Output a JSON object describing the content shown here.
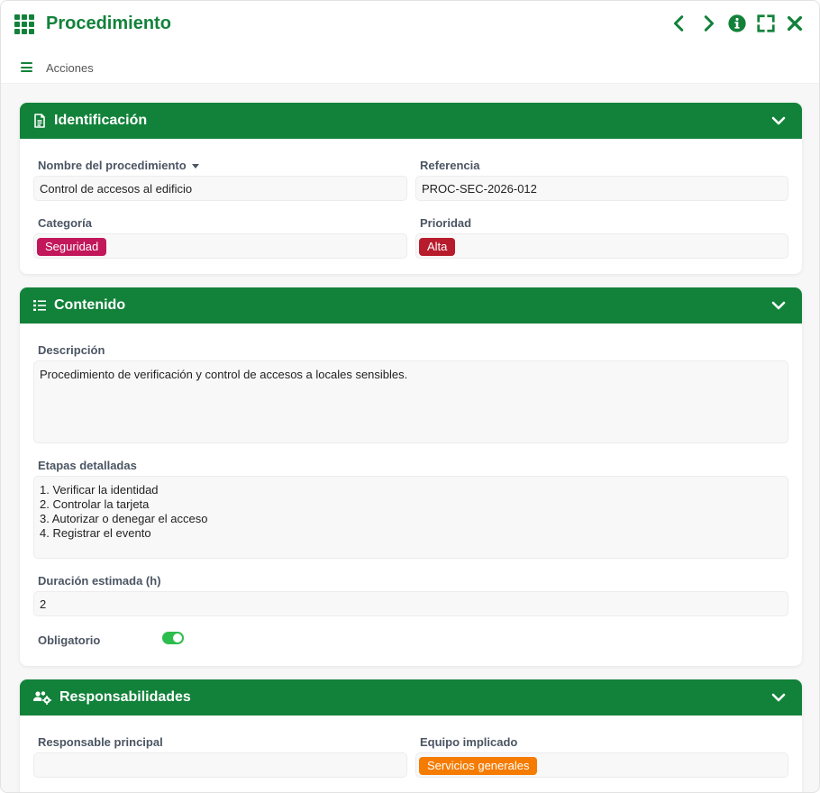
{
  "window": {
    "title": "Procedimiento"
  },
  "subbar": {
    "actions_label": "Acciones"
  },
  "colors": {
    "brand": "#12823a",
    "seguridad": "#c2185b",
    "alta": "#b71c2c",
    "servicios": "#f57c00",
    "toggle_on": "#2dbd4e"
  },
  "icons": {
    "app": "grid-icon",
    "prev": "chevron-left-icon",
    "next": "chevron-right-icon",
    "info": "info-icon",
    "fullscreen": "expand-icon",
    "close": "close-icon"
  },
  "sections": {
    "identificacion": {
      "title": "Identificación",
      "icon": "file-text-icon",
      "nombre": {
        "label": "Nombre del procedimiento",
        "value": "Control de accesos al edificio"
      },
      "referencia": {
        "label": "Referencia",
        "value": "PROC-SEC-2026-012"
      },
      "categoria": {
        "label": "Categoría",
        "value": "Seguridad"
      },
      "prioridad": {
        "label": "Prioridad",
        "value": "Alta"
      }
    },
    "contenido": {
      "title": "Contenido",
      "icon": "list-icon",
      "descripcion": {
        "label": "Descripción",
        "value": "Procedimiento de verificación y control de accesos a locales sensibles."
      },
      "etapas": {
        "label": "Etapas detalladas",
        "value": "1. Verificar la identidad\n2. Controlar la tarjeta\n3. Autorizar o denegar el acceso\n4. Registrar el evento"
      },
      "duracion": {
        "label": "Duración estimada (h)",
        "value": "2"
      },
      "obligatorio": {
        "label": "Obligatorio",
        "value": true
      }
    },
    "responsabilidades": {
      "title": "Responsabilidades",
      "icon": "users-cog-icon",
      "responsable": {
        "label": "Responsable principal",
        "value": ""
      },
      "equipo": {
        "label": "Equipo implicado",
        "value": "Servicios generales"
      }
    }
  }
}
